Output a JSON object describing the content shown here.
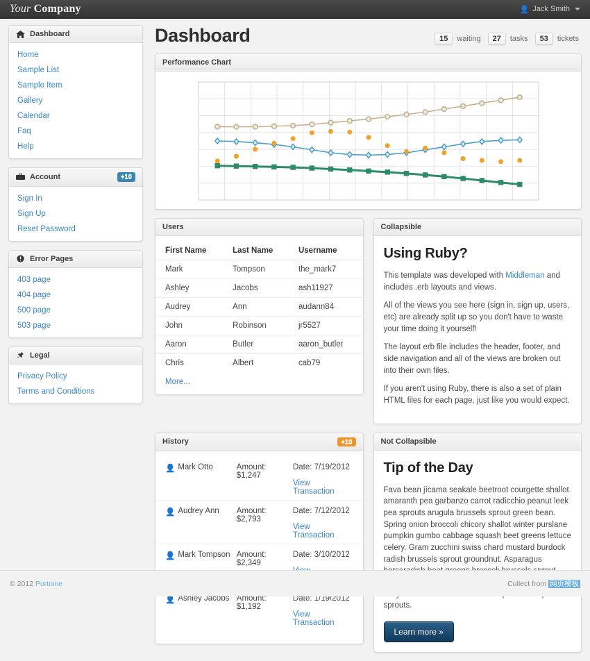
{
  "topbar": {
    "brand_italic": "Your",
    "brand_bold": "Company",
    "user_name": "Jack Smith",
    "person_icon": "person-icon",
    "caret_icon": "caret-down-icon"
  },
  "page": {
    "title": "Dashboard"
  },
  "stats": [
    {
      "count": "15",
      "label": "waiting"
    },
    {
      "count": "27",
      "label": "tasks"
    },
    {
      "count": "53",
      "label": "tickets"
    }
  ],
  "sidebar": {
    "panels": [
      {
        "title": "Dashboard",
        "icon": "home-icon",
        "badge": "",
        "items": [
          "Home",
          "Sample List",
          "Sample Item",
          "Gallery",
          "Calendar",
          "Faq",
          "Help"
        ]
      },
      {
        "title": "Account",
        "icon": "briefcase-icon",
        "badge": "+10",
        "items": [
          "Sign In",
          "Sign Up",
          "Reset Password"
        ]
      },
      {
        "title": "Error Pages",
        "icon": "exclamation-circle-icon",
        "badge": "",
        "items": [
          "403 page",
          "404 page",
          "500 page",
          "503 page"
        ]
      },
      {
        "title": "Legal",
        "icon": "pushpin-icon",
        "badge": "",
        "items": [
          "Privacy Policy",
          "Terms and Conditions"
        ]
      }
    ]
  },
  "chart_panel": {
    "title": "Performance Chart"
  },
  "chart_data": {
    "type": "line",
    "title": "Performance Chart",
    "xlabel": "",
    "ylabel": "",
    "grid": true,
    "legend": "none",
    "x": [
      1,
      2,
      3,
      4,
      5,
      6,
      7,
      8,
      9,
      10,
      11,
      12,
      13,
      14,
      15,
      16,
      17
    ],
    "xlim": [
      0,
      18
    ],
    "ylim": [
      0,
      100
    ],
    "series": [
      {
        "name": "Tan series",
        "color": "#c3b393",
        "marker": "circle",
        "type": "line",
        "values": [
          62,
          62,
          62,
          62.5,
          63,
          64,
          65.5,
          67,
          68.5,
          70.5,
          72.5,
          74.5,
          77,
          79.5,
          82,
          84.5,
          87
        ]
      },
      {
        "name": "Blue series",
        "color": "#4a9dc9",
        "marker": "diamond",
        "type": "line",
        "values": [
          50,
          49.5,
          48.5,
          47,
          45,
          42.5,
          40,
          38.5,
          38,
          38.5,
          40,
          42.5,
          45,
          47.5,
          49.5,
          50.5,
          51
        ]
      },
      {
        "name": "Green series",
        "color": "#2e8b68",
        "marker": "square",
        "type": "line",
        "values": [
          29,
          28.7,
          28.4,
          28,
          27.6,
          27,
          26.2,
          25.4,
          24.5,
          23.6,
          22.5,
          21.2,
          19.8,
          18.2,
          16.5,
          14.8,
          13.2
        ]
      },
      {
        "name": "Orange points",
        "color": "#f0a32b",
        "marker": "dot",
        "type": "scatter",
        "values": [
          33,
          37,
          43,
          48,
          52,
          57,
          58,
          57.5,
          53,
          46,
          41,
          44,
          40,
          35,
          33.5,
          32.5,
          33.5
        ]
      }
    ]
  },
  "users_panel": {
    "title": "Users",
    "columns": [
      "First Name",
      "Last Name",
      "Username"
    ],
    "rows": [
      [
        "Mark",
        "Tompson",
        "the_mark7"
      ],
      [
        "Ashley",
        "Jacobs",
        "ash11927"
      ],
      [
        "Audrey",
        "Ann",
        "audann84"
      ],
      [
        "John",
        "Robinson",
        "jr5527"
      ],
      [
        "Aaron",
        "Butler",
        "aaron_butler"
      ],
      [
        "Chris",
        "Albert",
        "cab79"
      ]
    ],
    "more_label": "More..."
  },
  "collapsible_panel": {
    "title": "Collapsible",
    "heading": "Using Ruby?",
    "p1_before": "This template was developed with ",
    "p1_link": "Middleman",
    "p1_after": " and includes .erb layouts and views.",
    "p2": "All of the views you see here (sign in, sign up, users, etc) are already split up so you don't have to waste your time doing it yourself!",
    "p3": "The layout erb file includes the header, footer, and side navigation and all of the views are broken out into their own files.",
    "p4": "If you aren't using Ruby, there is also a set of plain HTML files for each page, just like you would expect."
  },
  "history_panel": {
    "title": "History",
    "badge": "+10",
    "link_label": "View Transaction",
    "rows": [
      {
        "name": "Mark Otto",
        "amount": "Amount: $1,247",
        "date": "Date: 7/19/2012"
      },
      {
        "name": "Audrey Ann",
        "amount": "Amount: $2,793",
        "date": "Date: 7/12/2012"
      },
      {
        "name": "Mark Tompson",
        "amount": "Amount: $2,349",
        "date": "Date: 3/10/2012"
      },
      {
        "name": "Ashley Jacobs",
        "amount": "Amount: $1,192",
        "date": "Date: 1/19/2012"
      }
    ]
  },
  "not_collapsible_panel": {
    "title": "Not Collapsible",
    "heading": "Tip of the Day",
    "body": "Fava bean jícama seakale beetroot courgette shallot amaranth pea garbanzo carrot radicchio peanut leek pea sprouts arugula brussels sprout green bean. Spring onion broccoli chicory shallot winter purslane pumpkin gumbo cabbage squash beet greens lettuce celery. Gram zucchini swiss chard mustard burdock radish brussels sprout groundnut. Asparagus horseradish beet greens broccoli brussels sprout bitterleaf groundnut cress sweet pepper leek bok choy shallot celtuce scallion chickpea radish pea sprouts.",
    "button_label": "Learn more »"
  },
  "footer": {
    "copyright_prefix": "© 2012 ",
    "copyright_link": "Portnine",
    "collect_prefix": "Collect from ",
    "collect_link": "网页模板"
  },
  "colors": {
    "accent_link": "#3a87c8",
    "badge_blue": "#3a87ad",
    "badge_orange": "#f0932b",
    "tan": "#c3b393",
    "blue": "#4a9dc9",
    "green": "#2e8b68",
    "orange": "#f0a32b"
  }
}
